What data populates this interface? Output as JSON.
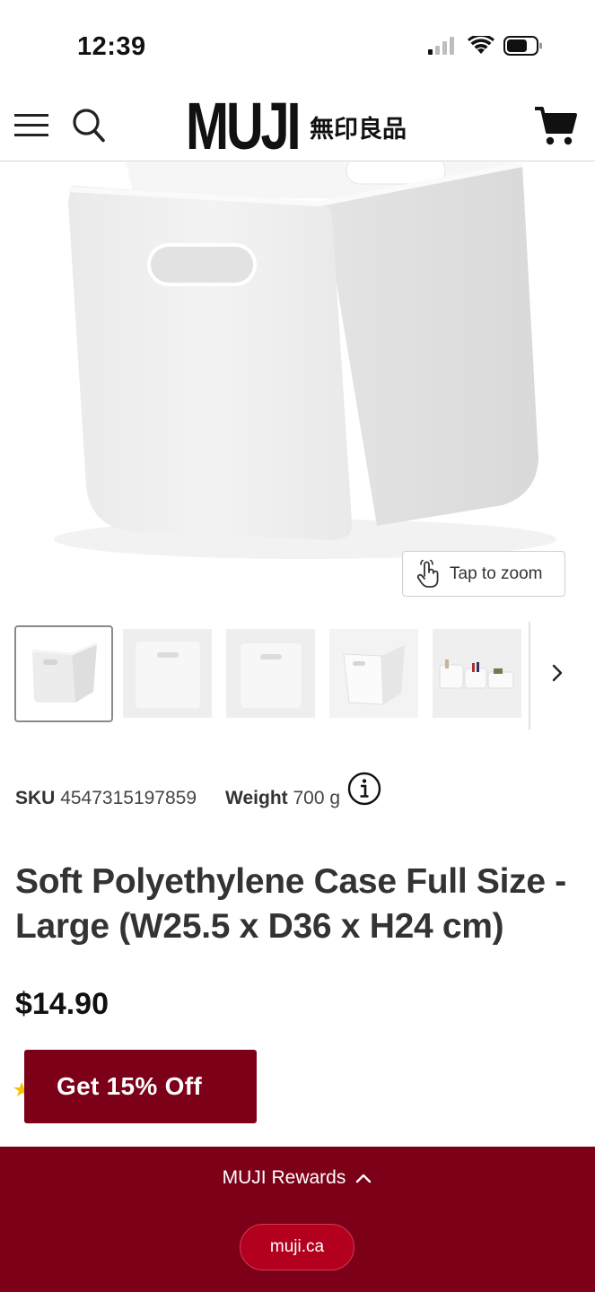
{
  "status_bar": {
    "time": "12:39",
    "icons": [
      "cellular-signal-icon",
      "wifi-icon",
      "battery-icon"
    ]
  },
  "header": {
    "logo_main": "MUJI",
    "logo_jp": "無印良品",
    "icons": [
      "menu-icon",
      "search-icon",
      "cart-icon"
    ]
  },
  "gallery": {
    "zoom_label": "Tap to zoom",
    "thumbnail_count": 5,
    "selected_index": 0
  },
  "product": {
    "sku_label": "SKU",
    "sku_value": "4547315197859",
    "weight_label": "Weight",
    "weight_value": "700 g",
    "title": "Soft Polyethylene Case Full Size - Large (W25.5 x D36 x H24 cm)",
    "price": "$14.90"
  },
  "offer": {
    "button_label": "Get 15% Off"
  },
  "rewards": {
    "label": "MUJI Rewards",
    "url": "muji.ca"
  },
  "colors": {
    "brand_red": "#7d0019",
    "url_pill": "#b3001f",
    "star": "#f2c200"
  }
}
